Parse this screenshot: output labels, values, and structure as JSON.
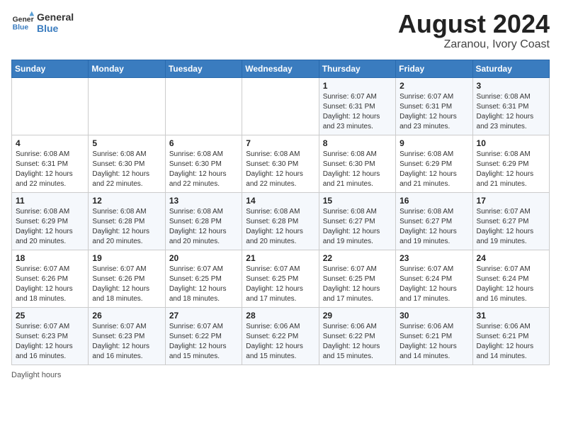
{
  "header": {
    "logo_line1": "General",
    "logo_line2": "Blue",
    "title": "August 2024",
    "subtitle": "Zaranou, Ivory Coast"
  },
  "days_of_week": [
    "Sunday",
    "Monday",
    "Tuesday",
    "Wednesday",
    "Thursday",
    "Friday",
    "Saturday"
  ],
  "weeks": [
    [
      {
        "day": "",
        "info": ""
      },
      {
        "day": "",
        "info": ""
      },
      {
        "day": "",
        "info": ""
      },
      {
        "day": "",
        "info": ""
      },
      {
        "day": "1",
        "info": "Sunrise: 6:07 AM\nSunset: 6:31 PM\nDaylight: 12 hours and 23 minutes."
      },
      {
        "day": "2",
        "info": "Sunrise: 6:07 AM\nSunset: 6:31 PM\nDaylight: 12 hours and 23 minutes."
      },
      {
        "day": "3",
        "info": "Sunrise: 6:08 AM\nSunset: 6:31 PM\nDaylight: 12 hours and 23 minutes."
      }
    ],
    [
      {
        "day": "4",
        "info": "Sunrise: 6:08 AM\nSunset: 6:31 PM\nDaylight: 12 hours and 22 minutes."
      },
      {
        "day": "5",
        "info": "Sunrise: 6:08 AM\nSunset: 6:30 PM\nDaylight: 12 hours and 22 minutes."
      },
      {
        "day": "6",
        "info": "Sunrise: 6:08 AM\nSunset: 6:30 PM\nDaylight: 12 hours and 22 minutes."
      },
      {
        "day": "7",
        "info": "Sunrise: 6:08 AM\nSunset: 6:30 PM\nDaylight: 12 hours and 22 minutes."
      },
      {
        "day": "8",
        "info": "Sunrise: 6:08 AM\nSunset: 6:30 PM\nDaylight: 12 hours and 21 minutes."
      },
      {
        "day": "9",
        "info": "Sunrise: 6:08 AM\nSunset: 6:29 PM\nDaylight: 12 hours and 21 minutes."
      },
      {
        "day": "10",
        "info": "Sunrise: 6:08 AM\nSunset: 6:29 PM\nDaylight: 12 hours and 21 minutes."
      }
    ],
    [
      {
        "day": "11",
        "info": "Sunrise: 6:08 AM\nSunset: 6:29 PM\nDaylight: 12 hours and 20 minutes."
      },
      {
        "day": "12",
        "info": "Sunrise: 6:08 AM\nSunset: 6:28 PM\nDaylight: 12 hours and 20 minutes."
      },
      {
        "day": "13",
        "info": "Sunrise: 6:08 AM\nSunset: 6:28 PM\nDaylight: 12 hours and 20 minutes."
      },
      {
        "day": "14",
        "info": "Sunrise: 6:08 AM\nSunset: 6:28 PM\nDaylight: 12 hours and 20 minutes."
      },
      {
        "day": "15",
        "info": "Sunrise: 6:08 AM\nSunset: 6:27 PM\nDaylight: 12 hours and 19 minutes."
      },
      {
        "day": "16",
        "info": "Sunrise: 6:08 AM\nSunset: 6:27 PM\nDaylight: 12 hours and 19 minutes."
      },
      {
        "day": "17",
        "info": "Sunrise: 6:07 AM\nSunset: 6:27 PM\nDaylight: 12 hours and 19 minutes."
      }
    ],
    [
      {
        "day": "18",
        "info": "Sunrise: 6:07 AM\nSunset: 6:26 PM\nDaylight: 12 hours and 18 minutes."
      },
      {
        "day": "19",
        "info": "Sunrise: 6:07 AM\nSunset: 6:26 PM\nDaylight: 12 hours and 18 minutes."
      },
      {
        "day": "20",
        "info": "Sunrise: 6:07 AM\nSunset: 6:25 PM\nDaylight: 12 hours and 18 minutes."
      },
      {
        "day": "21",
        "info": "Sunrise: 6:07 AM\nSunset: 6:25 PM\nDaylight: 12 hours and 17 minutes."
      },
      {
        "day": "22",
        "info": "Sunrise: 6:07 AM\nSunset: 6:25 PM\nDaylight: 12 hours and 17 minutes."
      },
      {
        "day": "23",
        "info": "Sunrise: 6:07 AM\nSunset: 6:24 PM\nDaylight: 12 hours and 17 minutes."
      },
      {
        "day": "24",
        "info": "Sunrise: 6:07 AM\nSunset: 6:24 PM\nDaylight: 12 hours and 16 minutes."
      }
    ],
    [
      {
        "day": "25",
        "info": "Sunrise: 6:07 AM\nSunset: 6:23 PM\nDaylight: 12 hours and 16 minutes."
      },
      {
        "day": "26",
        "info": "Sunrise: 6:07 AM\nSunset: 6:23 PM\nDaylight: 12 hours and 16 minutes."
      },
      {
        "day": "27",
        "info": "Sunrise: 6:07 AM\nSunset: 6:22 PM\nDaylight: 12 hours and 15 minutes."
      },
      {
        "day": "28",
        "info": "Sunrise: 6:06 AM\nSunset: 6:22 PM\nDaylight: 12 hours and 15 minutes."
      },
      {
        "day": "29",
        "info": "Sunrise: 6:06 AM\nSunset: 6:22 PM\nDaylight: 12 hours and 15 minutes."
      },
      {
        "day": "30",
        "info": "Sunrise: 6:06 AM\nSunset: 6:21 PM\nDaylight: 12 hours and 14 minutes."
      },
      {
        "day": "31",
        "info": "Sunrise: 6:06 AM\nSunset: 6:21 PM\nDaylight: 12 hours and 14 minutes."
      }
    ]
  ],
  "footer": "Daylight hours"
}
